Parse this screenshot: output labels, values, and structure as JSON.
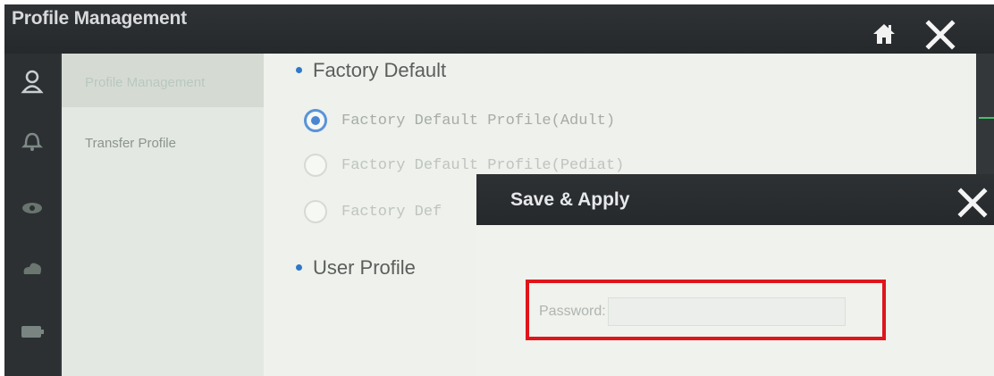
{
  "window": {
    "title": "Profile Management"
  },
  "nav": {
    "items": [
      {
        "label": "Profile Management"
      },
      {
        "label": "Transfer Profile"
      }
    ]
  },
  "rail_icons": [
    "user-icon",
    "bell-icon",
    "eye-icon",
    "cloud-icon",
    "battery-icon"
  ],
  "content": {
    "factory_section": "Factory Default",
    "options": [
      {
        "label": "Factory Default Profile(Adult)",
        "checked": true
      },
      {
        "label": "Factory Default Profile(Pediat)",
        "checked": false
      },
      {
        "label": "Factory Def",
        "checked": false
      }
    ],
    "user_section": "User Profile"
  },
  "dialog": {
    "title": "Save & Apply",
    "password_label": "Password:",
    "password_value": ""
  },
  "colors": {
    "accent": "#2f78c9",
    "highlight": "#e0141b",
    "titlebar": "#2b2e30"
  }
}
